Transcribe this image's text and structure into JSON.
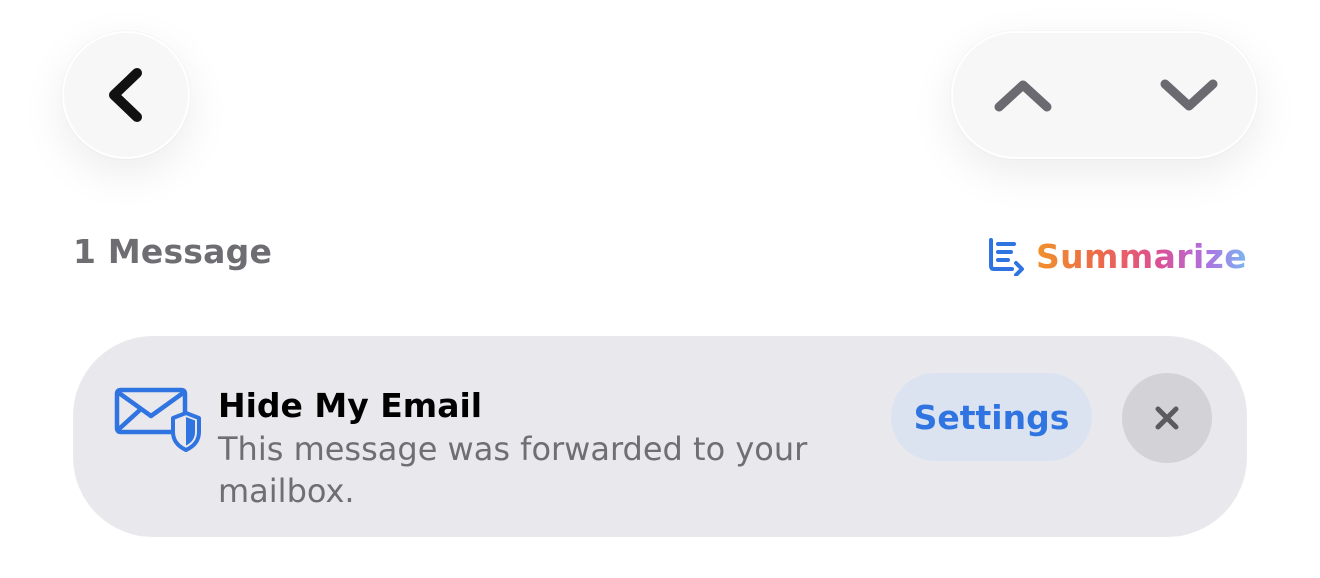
{
  "header": {
    "back_icon": "chevron-left-icon",
    "previous_icon": "chevron-up-icon",
    "next_icon": "chevron-down-icon"
  },
  "thread": {
    "message_count": "1 Message",
    "summarize_label": "Summarize",
    "summarize_icon": "summarize-icon"
  },
  "banner": {
    "icon": "envelope-shield-icon",
    "title": "Hide My Email",
    "body": "This message was forwarded to your mailbox.",
    "settings_label": "Settings",
    "close_icon": "close-icon"
  },
  "colors": {
    "accent_blue": "#2f74e0",
    "secondary_text": "#6e6e73",
    "banner_background": "#e9e9ed",
    "settings_background": "#dbe3f1",
    "close_background": "#d2d2d7",
    "icon_gray": "#6a6a70"
  }
}
